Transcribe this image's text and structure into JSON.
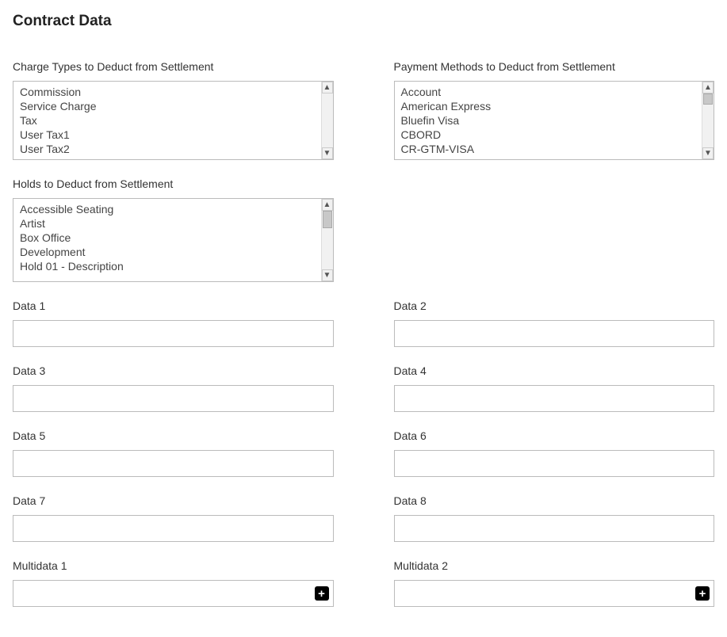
{
  "title": "Contract Data",
  "chargeTypes": {
    "label": "Charge Types to Deduct from Settlement",
    "items": [
      "Commission",
      "Service Charge",
      "Tax",
      "User Tax1",
      "User Tax2"
    ]
  },
  "paymentMethods": {
    "label": "Payment Methods to Deduct from Settlement",
    "items": [
      "Account",
      "American Express",
      "Bluefin Visa",
      "CBORD",
      "CR-GTM-VISA"
    ]
  },
  "holds": {
    "label": "Holds to Deduct from Settlement",
    "items": [
      "Accessible Seating",
      "Artist",
      "Box Office",
      "Development",
      "Hold 01 - Description"
    ]
  },
  "dataFields": {
    "d1": {
      "label": "Data 1",
      "value": ""
    },
    "d2": {
      "label": "Data 2",
      "value": ""
    },
    "d3": {
      "label": "Data 3",
      "value": ""
    },
    "d4": {
      "label": "Data 4",
      "value": ""
    },
    "d5": {
      "label": "Data 5",
      "value": ""
    },
    "d6": {
      "label": "Data 6",
      "value": ""
    },
    "d7": {
      "label": "Data 7",
      "value": ""
    },
    "d8": {
      "label": "Data 8",
      "value": ""
    }
  },
  "multidata": {
    "m1": {
      "label": "Multidata 1",
      "value": ""
    },
    "m2": {
      "label": "Multidata 2",
      "value": ""
    }
  }
}
